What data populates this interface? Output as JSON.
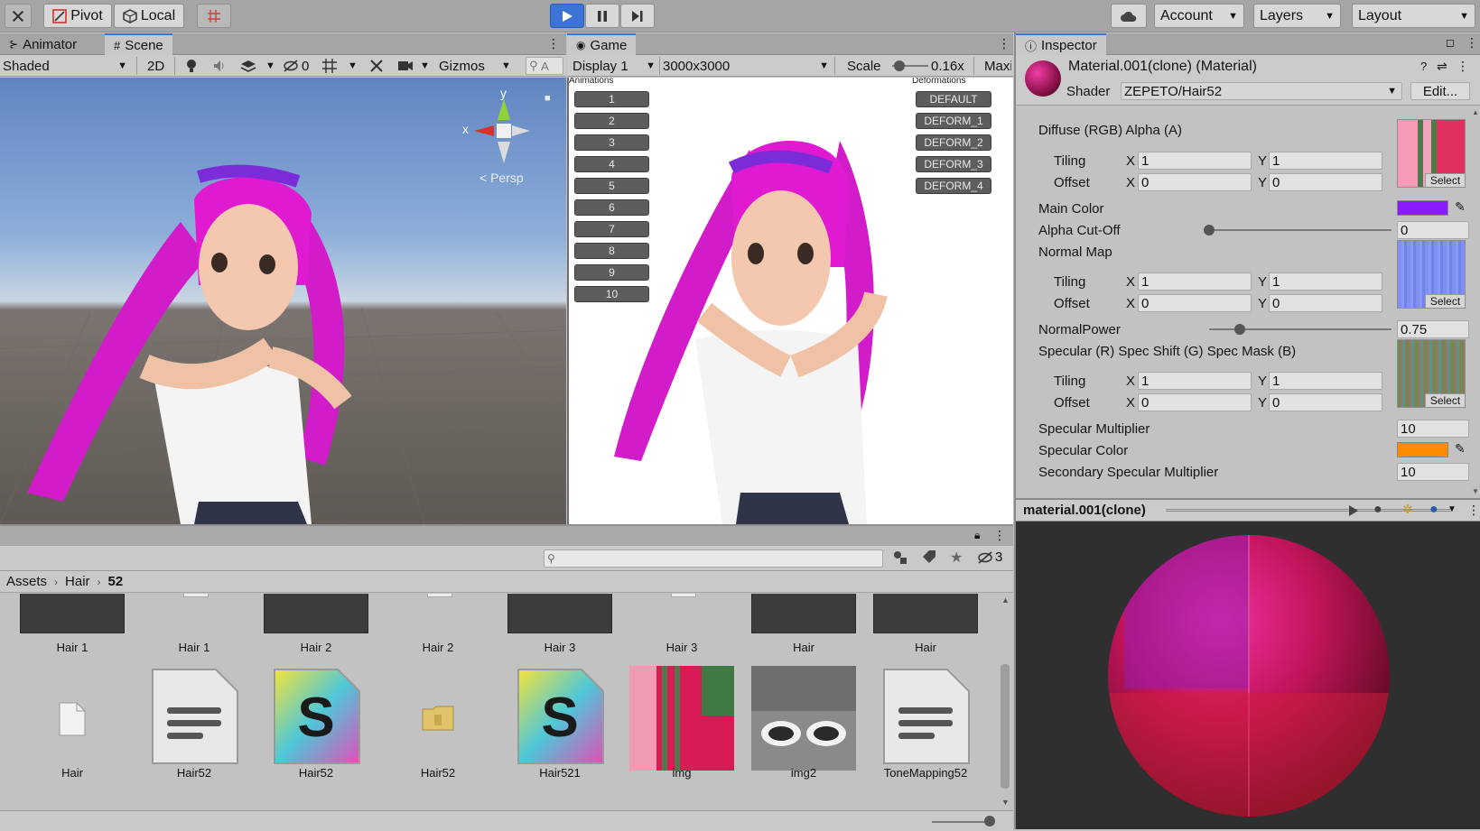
{
  "toolbar": {
    "pivot_label": "Pivot",
    "local_label": "Local",
    "account_label": "Account",
    "layers_label": "Layers",
    "layout_label": "Layout"
  },
  "scene_panel": {
    "tabs": [
      {
        "label": "Animator"
      },
      {
        "label": "Scene"
      }
    ],
    "shading_mode": "Shaded",
    "mode_2d": "2D",
    "hidden_count": "0",
    "gizmos_label": "Gizmos",
    "search_placeholder": "A",
    "axis_x": "x",
    "axis_y": "y",
    "persp_label": "Persp"
  },
  "game_panel": {
    "tab_label": "Game",
    "display": "Display 1",
    "resolution": "3000x3000",
    "scale_label": "Scale",
    "scale_value": "0.16x",
    "maximize_label": "Maxi",
    "animations_header": "Animations",
    "deformations_header": "Deformations",
    "animation_buttons": [
      "1",
      "2",
      "3",
      "4",
      "5",
      "6",
      "7",
      "8",
      "9",
      "10"
    ],
    "deformation_buttons": [
      "DEFAULT",
      "DEFORM_1",
      "DEFORM_2",
      "DEFORM_3",
      "DEFORM_4"
    ]
  },
  "inspector": {
    "tab_label": "Inspector",
    "material_name": "Material.001(clone) (Material)",
    "shader_label": "Shader",
    "shader_value": "ZEPETO/Hair52",
    "edit_label": "Edit...",
    "diffuse_label": "Diffuse (RGB) Alpha (A)",
    "tiling_label": "Tiling",
    "offset_label": "Offset",
    "x_label": "X",
    "y_label": "Y",
    "diffuse_tiling": [
      "1",
      "1"
    ],
    "diffuse_offset": [
      "0",
      "0"
    ],
    "select_label": "Select",
    "main_color_label": "Main Color",
    "main_color": "#8a1bff",
    "alpha_cutoff_label": "Alpha Cut-Off",
    "alpha_cutoff_value": "0",
    "alpha_cutoff_level": 0.0,
    "normal_map_label": "Normal Map",
    "normal_tiling": [
      "1",
      "1"
    ],
    "normal_offset": [
      "0",
      "0"
    ],
    "normal_power_label": "NormalPower",
    "normal_power_value": "0.75",
    "normal_power_level": 0.17,
    "specular_label": "Specular (R) Spec Shift (G) Spec Mask (B)",
    "spec_tiling": [
      "1",
      "1"
    ],
    "spec_offset": [
      "0",
      "0"
    ],
    "specular_multiplier_label": "Specular Multiplier",
    "specular_multiplier_value": "10",
    "specular_color_label": "Specular Color",
    "specular_color": "#ff8a00",
    "secondary_specular_label": "Secondary Specular Multiplier",
    "secondary_specular_value": "10"
  },
  "preview": {
    "title": "material.001(clone)"
  },
  "project": {
    "breadcrumb": [
      "Assets",
      "Hair",
      "52"
    ],
    "hidden_count": "3",
    "row1": [
      "Hair 1",
      "Hair 1",
      "Hair 2",
      "Hair 2",
      "Hair 3",
      "Hair 3",
      "Hair",
      "Hair"
    ],
    "row2": [
      "Hair",
      "Hair52",
      "Hair52",
      "Hair52",
      "Hair521",
      "img",
      "img2",
      "ToneMapping52"
    ],
    "shader_letter": "S"
  }
}
